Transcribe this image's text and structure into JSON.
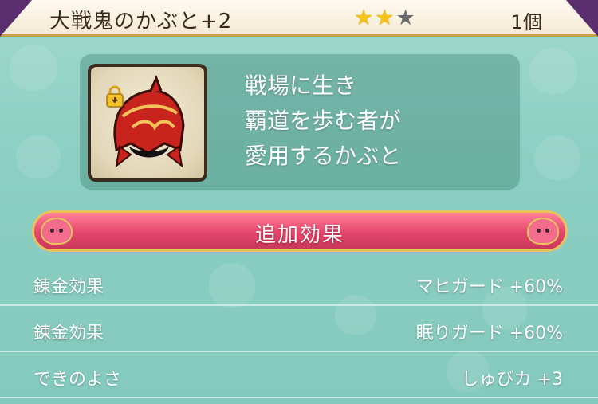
{
  "item": {
    "name": "大戦鬼のかぶと+2",
    "stars_filled": 2,
    "stars_total": 3,
    "quantity": "1個",
    "icon": "helmet-icon",
    "locked": true
  },
  "description": [
    "戦場に生き",
    "覇道を歩む者が",
    "愛用するかぶと"
  ],
  "section": {
    "title": "追加効果"
  },
  "effects": [
    {
      "label": "錬金効果",
      "value": "マヒガード +60%"
    },
    {
      "label": "錬金効果",
      "value": "眠りガード +60%"
    },
    {
      "label": "できのよさ",
      "value": "しゅびカ +3"
    }
  ],
  "colors": {
    "banner": "#e5466b",
    "gold": "#d6ad52",
    "star": "#f3c21b",
    "background": "#8ccfc2"
  }
}
